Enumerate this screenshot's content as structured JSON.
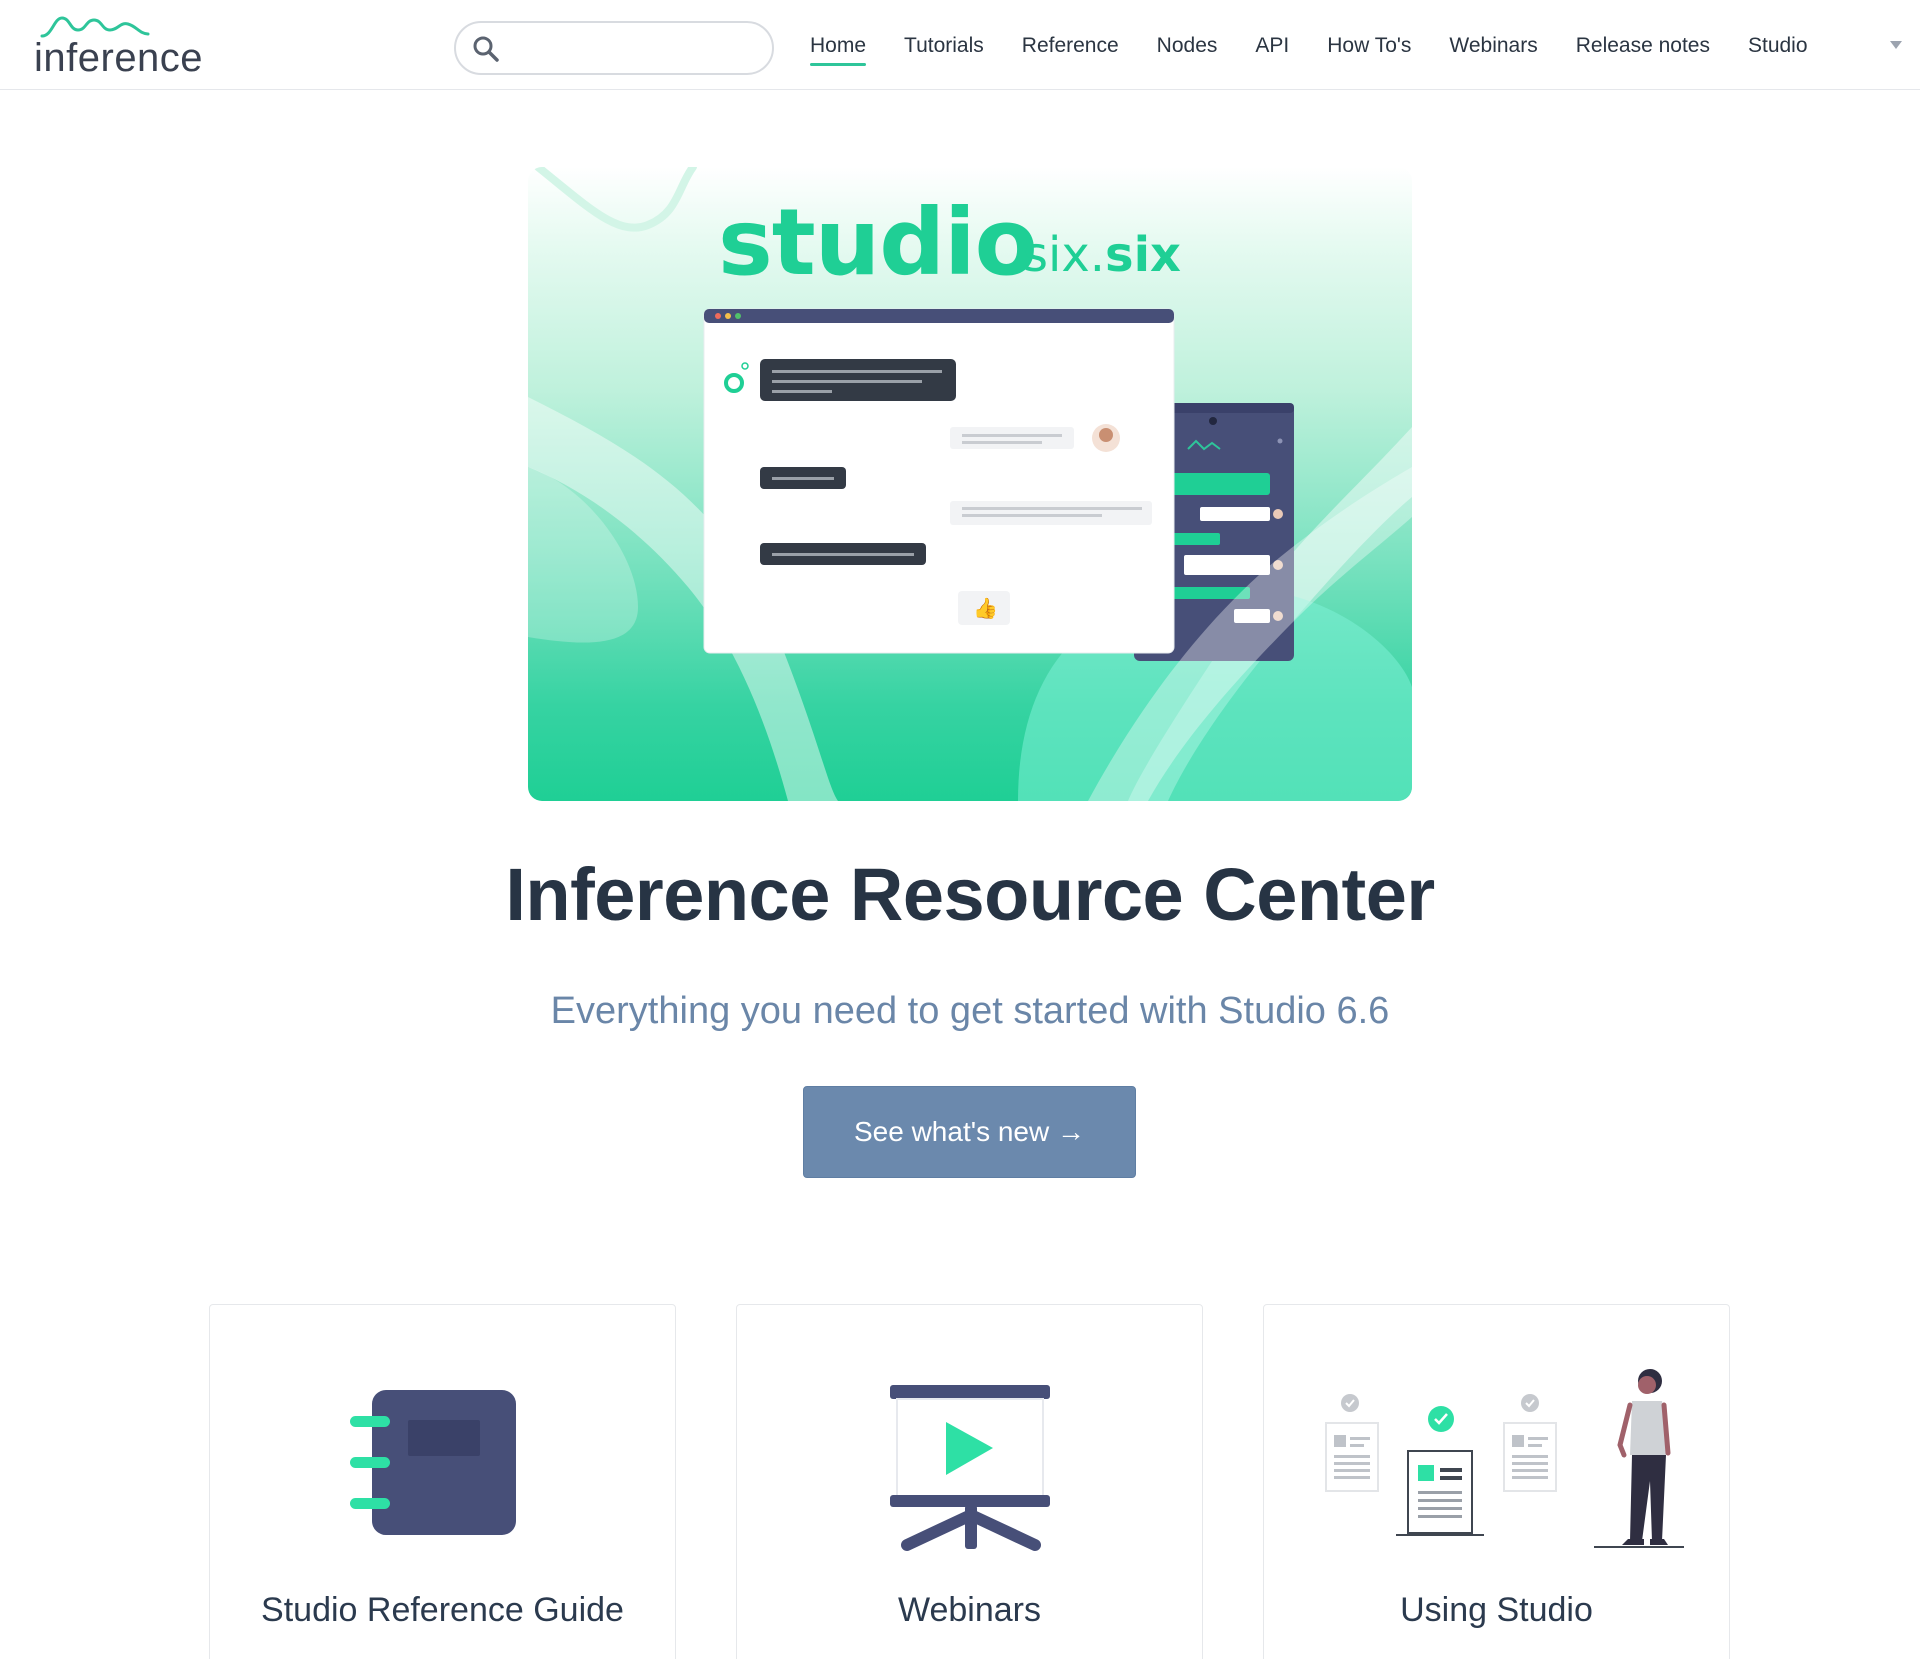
{
  "header": {
    "logo_text": "inference",
    "search": {
      "placeholder": "",
      "value": ""
    },
    "nav": [
      {
        "label": "Home",
        "active": true
      },
      {
        "label": "Tutorials"
      },
      {
        "label": "Reference"
      },
      {
        "label": "Nodes"
      },
      {
        "label": "API"
      },
      {
        "label": "How To's"
      },
      {
        "label": "Webinars"
      },
      {
        "label": "Release notes"
      },
      {
        "label": "Studio"
      }
    ]
  },
  "hero": {
    "title": "studio",
    "version_prefix": "six.",
    "version_suffix": "six"
  },
  "main": {
    "title": "Inference Resource Center",
    "subtitle": "Everything you need to get started with Studio 6.6",
    "cta_label": "See what's new →"
  },
  "cards": [
    {
      "title": "Studio Reference Guide",
      "icon": "notebook-icon"
    },
    {
      "title": "Webinars",
      "icon": "presentation-play-icon"
    },
    {
      "title": "Using Studio",
      "icon": "person-documents-icon"
    }
  ],
  "colors": {
    "accent": "#2ec59a",
    "brand_green": "#1fcf95",
    "cta": "#6b89ad",
    "navy": "#474f78",
    "text_dark": "#273444",
    "subtitle": "#6a86a8"
  }
}
